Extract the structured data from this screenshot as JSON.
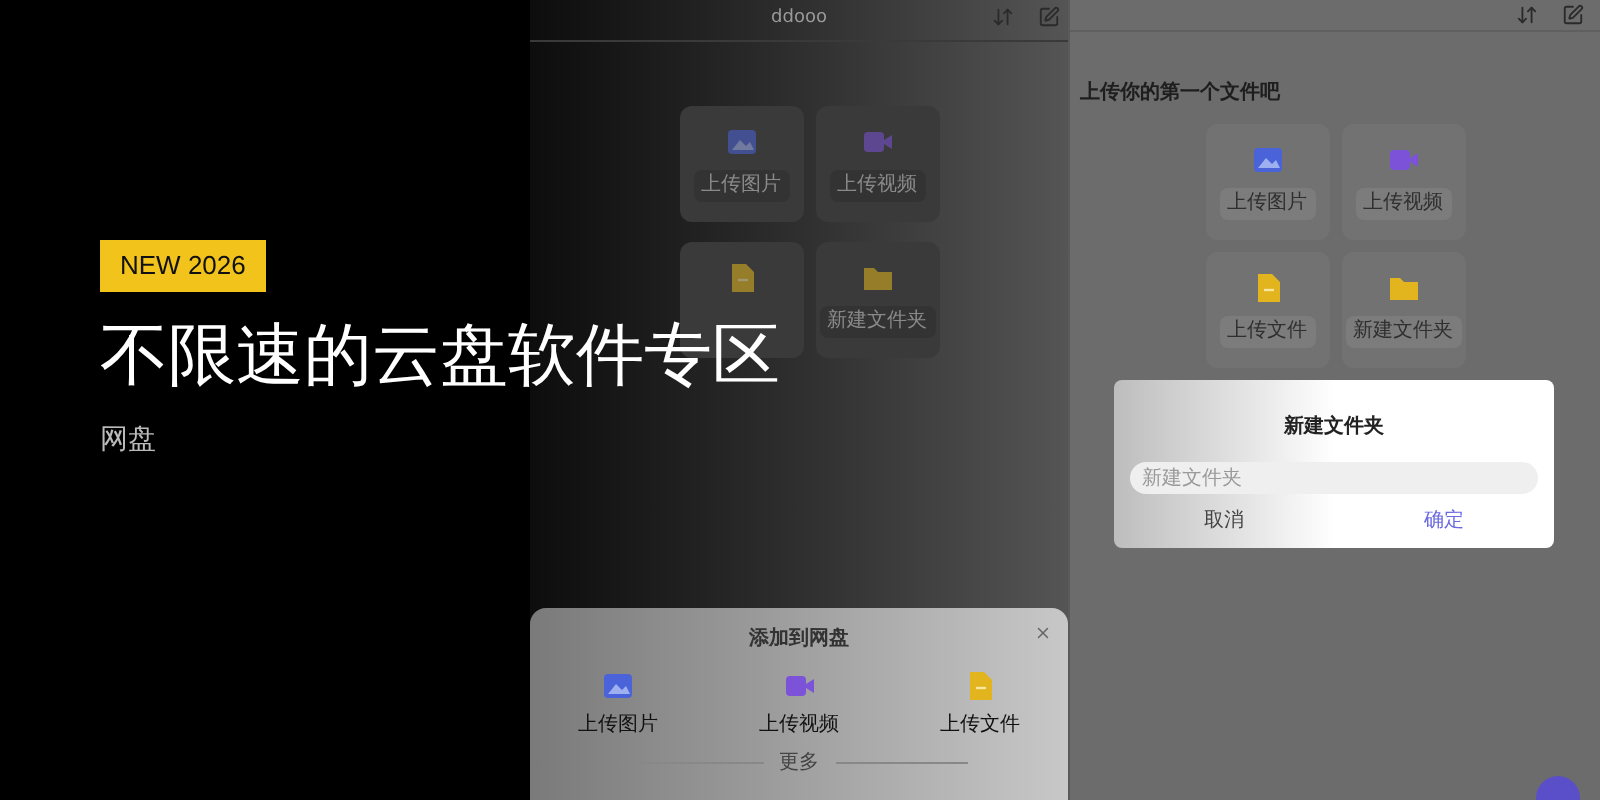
{
  "banner": {
    "badge": "NEW 2026",
    "title": "不限速的云盘软件专区",
    "subtitle": "网盘"
  },
  "left_screen": {
    "title": "ddooo",
    "tiles": [
      {
        "kind": "image",
        "label": "上传图片"
      },
      {
        "kind": "video",
        "label": "上传视频"
      },
      {
        "kind": "file"
      },
      {
        "kind": "folder",
        "label": "新建文件夹"
      }
    ],
    "sheet": {
      "title": "添加到网盘",
      "items": [
        {
          "kind": "image",
          "label": "上传图片"
        },
        {
          "kind": "video",
          "label": "上传视频"
        },
        {
          "kind": "file",
          "label": "上传文件"
        }
      ],
      "divider": "更多"
    }
  },
  "right_screen": {
    "heading": "上传你的第一个文件吧",
    "tiles": [
      {
        "kind": "image",
        "label": "上传图片"
      },
      {
        "kind": "video",
        "label": "上传视频"
      },
      {
        "kind": "file",
        "label": "上传文件"
      },
      {
        "kind": "folder",
        "label": "新建文件夹"
      }
    ],
    "dialog": {
      "title": "新建文件夹",
      "placeholder": "新建文件夹",
      "buttons": [
        {
          "kind": "cancel",
          "label": "取消"
        },
        {
          "kind": "confirm",
          "label": "确定"
        }
      ]
    }
  }
}
